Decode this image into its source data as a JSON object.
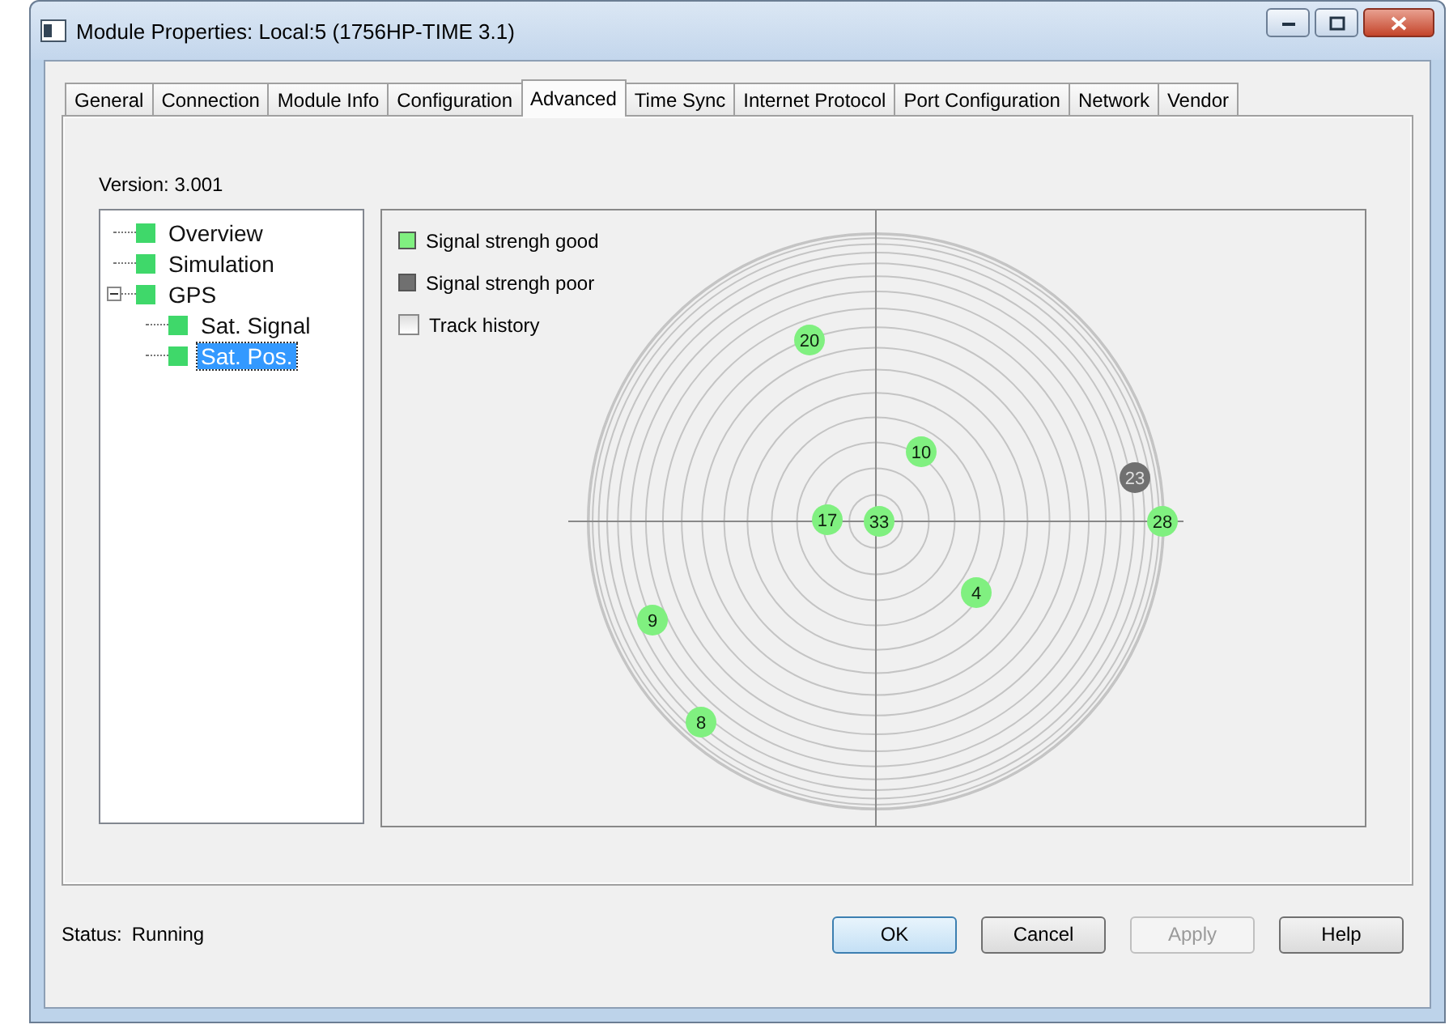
{
  "window": {
    "title": "Module Properties: Local:5 (1756HP-TIME 3.1)"
  },
  "tabs": [
    {
      "label": "General",
      "selected": false
    },
    {
      "label": "Connection",
      "selected": false
    },
    {
      "label": "Module Info",
      "selected": false
    },
    {
      "label": "Configuration",
      "selected": false
    },
    {
      "label": "Advanced",
      "selected": true
    },
    {
      "label": "Time Sync",
      "selected": false
    },
    {
      "label": "Internet Protocol",
      "selected": false
    },
    {
      "label": "Port Configuration",
      "selected": false
    },
    {
      "label": "Network",
      "selected": false
    },
    {
      "label": "Vendor",
      "selected": false
    }
  ],
  "version": "Version: 3.001",
  "tree": [
    {
      "label": "Overview",
      "selected": false
    },
    {
      "label": "Simulation",
      "selected": false
    },
    {
      "label": "GPS",
      "selected": false,
      "expanded": true,
      "children": [
        {
          "label": "Sat. Signal",
          "selected": false
        },
        {
          "label": "Sat. Pos.",
          "selected": true
        }
      ]
    }
  ],
  "legend": [
    {
      "kind": "swatch",
      "label": "Signal strengh good",
      "color": "#80f080"
    },
    {
      "kind": "swatch",
      "label": "Signal strengh poor",
      "color": "#707070"
    },
    {
      "kind": "checkbox",
      "label": "Track history",
      "checked": false
    }
  ],
  "satellites": [
    {
      "label": "20",
      "kind": "good"
    },
    {
      "label": "10",
      "kind": "good"
    },
    {
      "label": "23",
      "kind": "poor"
    },
    {
      "label": "17",
      "kind": "good"
    },
    {
      "label": "33",
      "kind": "good"
    },
    {
      "label": "28",
      "kind": "good"
    },
    {
      "label": "4",
      "kind": "good"
    },
    {
      "label": "9",
      "kind": "good"
    },
    {
      "label": "8",
      "kind": "good"
    }
  ],
  "status": {
    "label": "Status:",
    "value": "Running"
  },
  "buttons": [
    {
      "label": "OK",
      "default": true,
      "disabled": false
    },
    {
      "label": "Cancel",
      "default": false,
      "disabled": false
    },
    {
      "label": "Apply",
      "default": false,
      "disabled": true
    },
    {
      "label": "Help",
      "default": false,
      "disabled": false
    }
  ]
}
